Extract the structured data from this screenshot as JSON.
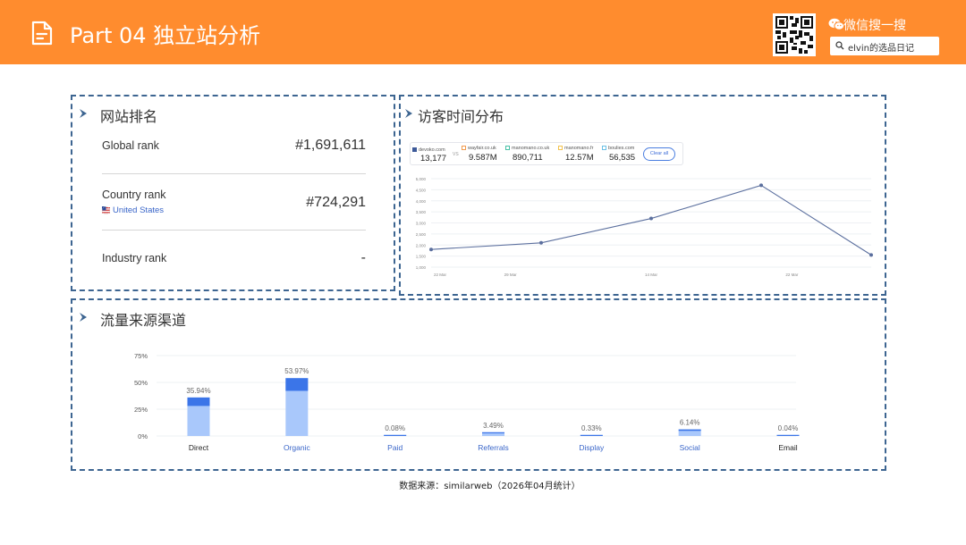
{
  "header": {
    "title": "Part 04 独立站分析",
    "wechat_label": "微信搜一搜",
    "search_text": "elvin的选品日记",
    "colors": {
      "bar": "#ff8c2e",
      "text": "#ffffff"
    }
  },
  "rank_panel": {
    "title": "网站排名",
    "global": {
      "label": "Global rank",
      "value": "#1,691,611"
    },
    "country": {
      "label": "Country rank",
      "country": "United States",
      "value": "#724,291"
    },
    "industry": {
      "label": "Industry rank",
      "value": "-"
    }
  },
  "time_panel": {
    "title": "访客时间分布",
    "compare": [
      {
        "site": "devoko.com",
        "value": "13,177",
        "color": "#3d5a99",
        "filled": true
      },
      {
        "site": "wayfair.co.uk",
        "value": "9.587M",
        "color": "#f19a4c",
        "filled": false
      },
      {
        "site": "manomano.co.uk",
        "value": "890,711",
        "color": "#47c0a6",
        "filled": false
      },
      {
        "site": "manomano.fr",
        "value": "12.57M",
        "color": "#f3c34e",
        "filled": false
      },
      {
        "site": "boulies.com",
        "value": "56,535",
        "color": "#6cc1e6",
        "filled": false
      }
    ],
    "vs_label": "VS",
    "clear_label": "Clear all",
    "chart_data": {
      "type": "line",
      "x": [
        "22 Mar",
        "29 Mar",
        "",
        "14 Mar",
        "",
        "22 Mar",
        ""
      ],
      "yticks": [
        "1,000",
        "1,500",
        "2,000",
        "2,500",
        "3,000",
        "3,500",
        "4,000",
        "4,500",
        "5,000"
      ],
      "ylim": [
        1000,
        5000
      ],
      "series": [
        {
          "values": [
            1800,
            2100,
            3200,
            4700,
            1550
          ],
          "color": "#5b6f9e"
        }
      ]
    }
  },
  "traffic_panel": {
    "title": "流量来源渠道",
    "chart_data": {
      "type": "bar",
      "categories": [
        "Direct",
        "Organic",
        "Paid",
        "Referrals",
        "Display",
        "Social",
        "Email"
      ],
      "category_link": [
        false,
        true,
        true,
        true,
        true,
        true,
        false
      ],
      "values": [
        35.94,
        53.97,
        0.08,
        3.49,
        0.33,
        6.14,
        0.04
      ],
      "labels": [
        "35.94%",
        "53.97%",
        "0.08%",
        "3.49%",
        "0.33%",
        "6.14%",
        "0.04%"
      ],
      "yticks": [
        "0%",
        "25%",
        "50%",
        "75%"
      ],
      "ylim": [
        0,
        75
      ],
      "colors": {
        "top": "#3b75e8",
        "bottom": "#a9c8fb",
        "link": "#3a66c9"
      }
    }
  },
  "footer": {
    "source": "数据来源：similarweb（2026年04月统计）"
  }
}
